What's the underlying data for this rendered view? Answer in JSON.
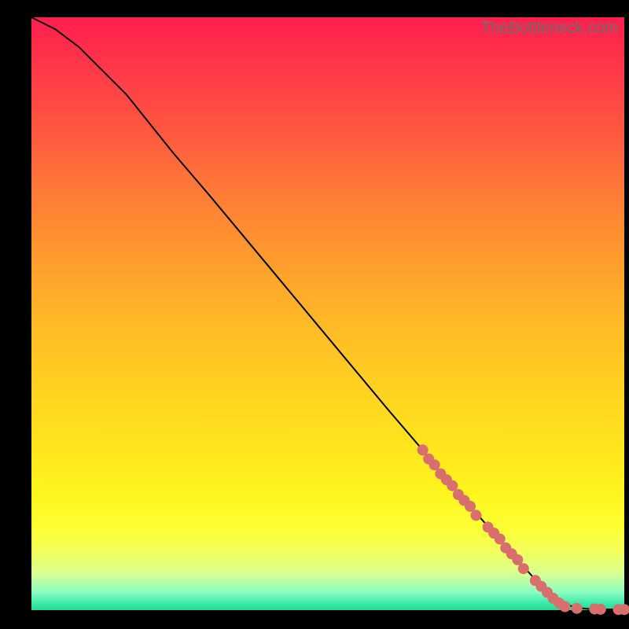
{
  "watermark": "TheBottleneck.com",
  "chart_data": {
    "type": "line",
    "title": "",
    "xlabel": "",
    "ylabel": "",
    "xlim": [
      0,
      100
    ],
    "ylim": [
      0,
      100
    ],
    "grid": false,
    "legend": false,
    "gradient_background": {
      "top": "#ff1f4f",
      "mid": "#ffe41e",
      "bottom": "#26d897"
    },
    "series": [
      {
        "name": "curve",
        "type": "line",
        "color": "#000000",
        "x": [
          0,
          4,
          8,
          12,
          16,
          20,
          24,
          30,
          40,
          50,
          60,
          66,
          70,
          74,
          78,
          82,
          86,
          88,
          90,
          92,
          94,
          96,
          98,
          100
        ],
        "y": [
          100,
          98,
          95,
          91,
          87,
          82,
          77,
          70,
          58,
          46,
          34,
          27,
          22,
          17.5,
          13,
          8.5,
          4,
          2,
          1,
          0.4,
          0.2,
          0.15,
          0.12,
          0.1
        ]
      },
      {
        "name": "dots",
        "type": "scatter",
        "color": "#d96f6d",
        "x": [
          66,
          67,
          68,
          69,
          70,
          71,
          72,
          73,
          74,
          75,
          77,
          78,
          79,
          80,
          81,
          82,
          83,
          85,
          86,
          87,
          88,
          89,
          90,
          92,
          95,
          96,
          99,
          100
        ],
        "y": [
          27,
          25.5,
          24.5,
          23,
          22,
          21,
          19.5,
          18.5,
          17.5,
          16,
          14,
          13,
          12,
          10.5,
          9.5,
          8.5,
          7,
          5,
          4,
          3,
          2,
          1.2,
          0.6,
          0.3,
          0.2,
          0.15,
          0.1,
          0.1
        ]
      }
    ]
  }
}
